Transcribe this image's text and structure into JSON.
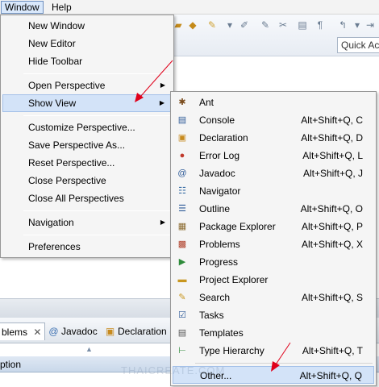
{
  "menubar": {
    "items": [
      "Window",
      "Help"
    ]
  },
  "toolbar": {
    "quick_access_placeholder": "Quick Ac"
  },
  "window_menu": {
    "items": [
      {
        "label": "New Window",
        "submenu": false
      },
      {
        "label": "New Editor",
        "submenu": false
      },
      {
        "label": "Hide Toolbar",
        "submenu": false
      },
      {
        "label": "Open Perspective",
        "submenu": true
      },
      {
        "label": "Show View",
        "submenu": true,
        "highlighted": true
      },
      {
        "label": "Customize Perspective...",
        "submenu": false
      },
      {
        "label": "Save Perspective As...",
        "submenu": false
      },
      {
        "label": "Reset Perspective...",
        "submenu": false
      },
      {
        "label": "Close Perspective",
        "submenu": false
      },
      {
        "label": "Close All Perspectives",
        "submenu": false
      },
      {
        "label": "Navigation",
        "submenu": true
      },
      {
        "label": "Preferences",
        "submenu": false
      }
    ]
  },
  "show_view_menu": {
    "items": [
      {
        "label": "Ant",
        "shortcut": "",
        "icon": "ant-icon"
      },
      {
        "label": "Console",
        "shortcut": "Alt+Shift+Q, C",
        "icon": "console-icon"
      },
      {
        "label": "Declaration",
        "shortcut": "Alt+Shift+Q, D",
        "icon": "declaration-icon"
      },
      {
        "label": "Error Log",
        "shortcut": "Alt+Shift+Q, L",
        "icon": "error-log-icon"
      },
      {
        "label": "Javadoc",
        "shortcut": "Alt+Shift+Q, J",
        "icon": "javadoc-icon"
      },
      {
        "label": "Navigator",
        "shortcut": "",
        "icon": "navigator-icon"
      },
      {
        "label": "Outline",
        "shortcut": "Alt+Shift+Q, O",
        "icon": "outline-icon"
      },
      {
        "label": "Package Explorer",
        "shortcut": "Alt+Shift+Q, P",
        "icon": "package-explorer-icon"
      },
      {
        "label": "Problems",
        "shortcut": "Alt+Shift+Q, X",
        "icon": "problems-icon"
      },
      {
        "label": "Progress",
        "shortcut": "",
        "icon": "progress-icon"
      },
      {
        "label": "Project Explorer",
        "shortcut": "",
        "icon": "project-explorer-icon"
      },
      {
        "label": "Search",
        "shortcut": "Alt+Shift+Q, S",
        "icon": "search-icon"
      },
      {
        "label": "Tasks",
        "shortcut": "",
        "icon": "tasks-icon"
      },
      {
        "label": "Templates",
        "shortcut": "",
        "icon": "templates-icon"
      },
      {
        "label": "Type Hierarchy",
        "shortcut": "Alt+Shift+Q, T",
        "icon": "type-hierarchy-icon"
      },
      {
        "label": "Other...",
        "shortcut": "Alt+Shift+Q, Q",
        "icon": "other-icon",
        "highlighted": true
      }
    ]
  },
  "bottom_tabs": [
    {
      "label": "blems",
      "active": true
    },
    {
      "label": "Javadoc",
      "active": false
    },
    {
      "label": "Declaration",
      "active": false
    }
  ],
  "table": {
    "column_header": "ption"
  },
  "watermark": "THAICREATE.COM",
  "colors": {
    "arrow": "#e0001a",
    "highlight": "#d3e3f8"
  }
}
